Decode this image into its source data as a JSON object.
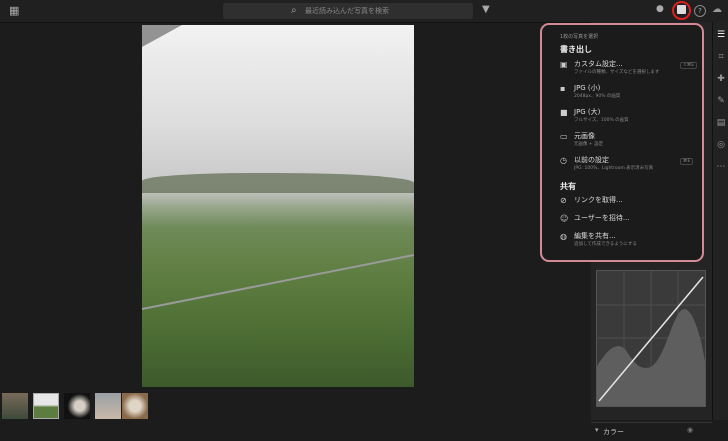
{
  "topbar": {
    "search_placeholder": "最近読み込んだ写真を検索"
  },
  "popup": {
    "title": "1枚の写真を選択",
    "export_heading": "書き出し",
    "export_items": [
      {
        "label": "カスタム設定...",
        "sub": "ファイルの種類、サイズなどを選択します",
        "key": "⇧⌘E",
        "icon": "custom-export-icon"
      },
      {
        "label": "JPG (小)",
        "sub": "2048px、90% の画質",
        "key": "",
        "icon": "jpg-small-icon"
      },
      {
        "label": "JPG (大)",
        "sub": "フルサイズ、100% の画質",
        "key": "",
        "icon": "jpg-large-icon"
      },
      {
        "label": "元画像",
        "sub": "元画像 + 設定",
        "key": "",
        "icon": "original-icon"
      },
      {
        "label": "以前の設定",
        "sub": "JPG: 100%、Lightroom 表示済み写真",
        "key": "⌘E",
        "icon": "history-icon"
      }
    ],
    "share_heading": "共有",
    "share_items": [
      {
        "label": "リンクを取得...",
        "sub": "",
        "icon": "link-icon"
      },
      {
        "label": "ユーザーを招待...",
        "sub": "",
        "icon": "invite-icon"
      },
      {
        "label": "編集を共有...",
        "sub": "追加して作成できるようにする",
        "icon": "share-edit-icon"
      }
    ]
  },
  "right_panel": {
    "color_label": "カラー"
  }
}
